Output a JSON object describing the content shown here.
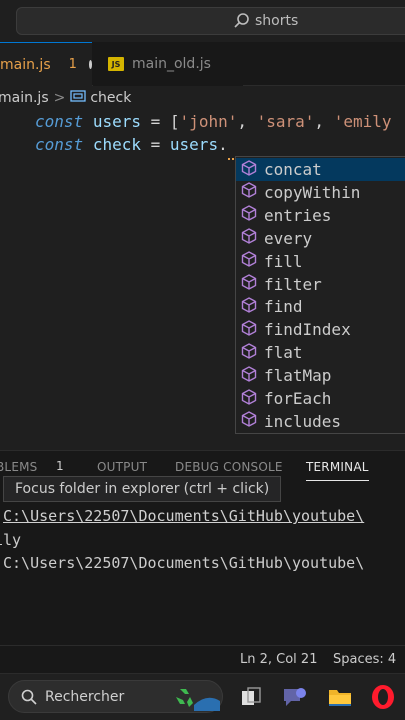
{
  "titlebar": {
    "search_text": "shorts"
  },
  "tabs": [
    {
      "name": "main.js",
      "badge_count": "1",
      "active": true
    },
    {
      "name": "main_old.js",
      "icon_label": "JS",
      "active": false
    }
  ],
  "breadcrumb": {
    "file": "main.js",
    "separator": ">",
    "symbol": "check"
  },
  "code": {
    "line1": {
      "kw": "const",
      "var": "users",
      "op": "=",
      "open": "[",
      "s1": "'john'",
      "c1": ",",
      "s2": "'sara'",
      "c2": ",",
      "s3": "'emily"
    },
    "line2": {
      "kw": "const",
      "var": "check",
      "op": "=",
      "obj": "users",
      "dot": "."
    }
  },
  "suggestions": [
    {
      "label": "concat",
      "selected": true
    },
    {
      "label": "copyWithin"
    },
    {
      "label": "entries"
    },
    {
      "label": "every"
    },
    {
      "label": "fill"
    },
    {
      "label": "filter"
    },
    {
      "label": "find"
    },
    {
      "label": "findIndex"
    },
    {
      "label": "flat"
    },
    {
      "label": "flatMap"
    },
    {
      "label": "forEach"
    },
    {
      "label": "includes"
    }
  ],
  "panel": {
    "tabs": {
      "problems": "BLEMS",
      "problems_count": "1",
      "output": "OUTPUT",
      "debug": "DEBUG CONSOLE",
      "terminal": "TERMINAL"
    },
    "tooltip": {
      "text": "Focus folder in explorer",
      "hint": "(ctrl + click)"
    },
    "terminal_lines": [
      "C:\\Users\\22507\\Documents\\GitHub\\youtube\\",
      "ily",
      "C:\\Users\\22507\\Documents\\GitHub\\youtube\\"
    ]
  },
  "statusbar": {
    "position": "Ln 2, Col 21",
    "spaces": "Spaces: 4"
  },
  "taskbar": {
    "search_placeholder": "Rechercher"
  },
  "colors": {
    "accent": "#0078d4",
    "warning": "#e8a14a",
    "method_icon": "#b180d7",
    "selection": "#04395e"
  }
}
